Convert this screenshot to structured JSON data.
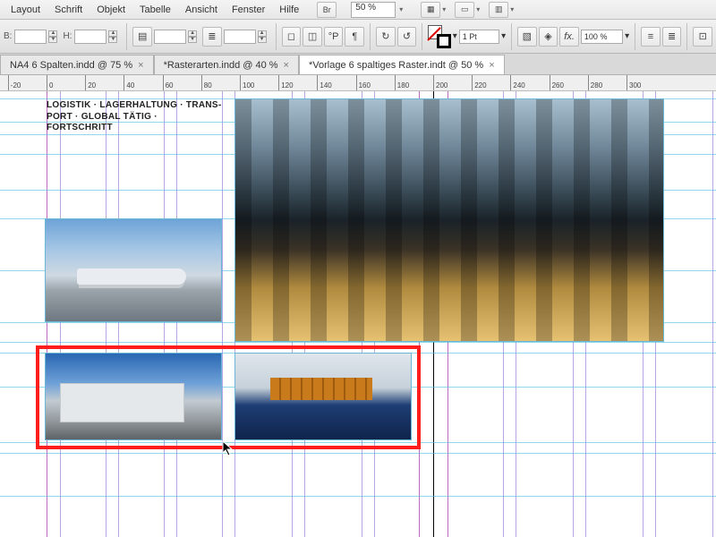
{
  "menu": {
    "items": [
      "Layout",
      "Schrift",
      "Objekt",
      "Tabelle",
      "Ansicht",
      "Fenster",
      "Hilfe"
    ],
    "bridge_label": "Br",
    "zoom": "50 %"
  },
  "control": {
    "b_label": "B:",
    "h_label": "H:",
    "b_value": "",
    "h_value": "",
    "stroke_weight": "1 Pt",
    "opacity": "100 %",
    "fx_label": "fx."
  },
  "tabs": [
    {
      "label": "NA4 6 Spalten.indd @ 75 %",
      "active": false
    },
    {
      "label": "*Rasterarten.indd @ 40 %",
      "active": false
    },
    {
      "label": "*Vorlage 6 spaltiges Raster.indt @ 50 %",
      "active": true
    }
  ],
  "ruler_ticks": [
    -20,
    0,
    20,
    40,
    60,
    80,
    100,
    120,
    140,
    160,
    180,
    200,
    220,
    240,
    260,
    280,
    300
  ],
  "text_block": {
    "line1": "LOGISTIK · LAGERHALTUNG · TRANS-",
    "line2": "PORT · GLOBAL TÄTIG · FORTSCHRITT"
  },
  "frames": {
    "city": {
      "name": "image-city-skyline"
    },
    "plane": {
      "name": "image-airplane"
    },
    "truck": {
      "name": "image-truck"
    },
    "ship": {
      "name": "image-container-ship"
    }
  },
  "icons": {
    "chevron": "▾",
    "close": "×"
  }
}
